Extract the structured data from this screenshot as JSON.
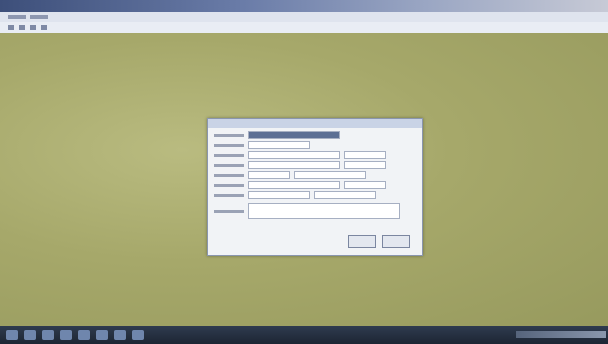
{
  "window": {
    "title": ""
  },
  "dialog": {
    "title": "",
    "ok_label": "",
    "cancel_label": ""
  },
  "taskbar": {
    "icons": [
      "start-icon",
      "browser-icon",
      "folder-icon",
      "app-icon",
      "app-icon",
      "app-icon",
      "app-icon",
      "app-icon"
    ]
  }
}
